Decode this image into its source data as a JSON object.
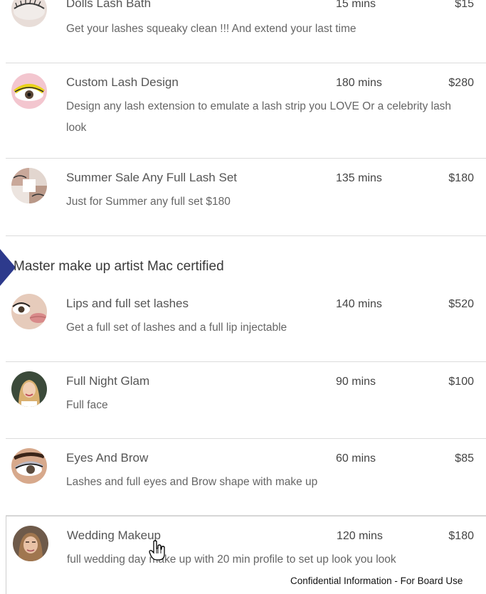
{
  "services_top": [
    {
      "name": "Dolls Lash Bath",
      "duration": "15 mins",
      "price": "$15",
      "description": "Get your lashes squeaky clean !!! And extend your last time",
      "avatar": "lash-eye-avatar"
    },
    {
      "name": "Custom Lash Design",
      "duration": "180 mins",
      "price": "$280",
      "description": "Design any lash extension to emulate a lash strip you LOVE Or a celebrity lash look",
      "avatar": "yellow-lash-avatar"
    },
    {
      "name": "Summer Sale Any Full Lash Set",
      "duration": "135 mins",
      "price": "$180",
      "description": "Just for Summer any full set $180",
      "avatar": "collage-avatar"
    }
  ],
  "section": {
    "title": "Master make up artist Mac certified"
  },
  "services_section": [
    {
      "name": "Lips and full set lashes",
      "duration": "140 mins",
      "price": "$520",
      "description": "Get a full set of lashes and a full lip injectable",
      "avatar": "lips-eye-avatar"
    },
    {
      "name": "Full Night Glam",
      "duration": "90 mins",
      "price": "$100",
      "description": "Full face",
      "avatar": "glam-portrait-avatar"
    },
    {
      "name": "Eyes And Brow",
      "duration": "60 mins",
      "price": "$85",
      "description": "Lashes and full eyes and Brow shape with make up",
      "avatar": "eye-brow-avatar"
    },
    {
      "name": "Wedding Makeup",
      "duration": "120 mins",
      "price": "$180",
      "description": "full wedding day make up with 20 min profile to set up look you look",
      "avatar": "bride-portrait-avatar"
    }
  ],
  "footer": {
    "text": "Confidential Information - For Board Use"
  },
  "colors": {
    "accent_arrow": "#2d3a8c",
    "divider": "#dcdcdc"
  }
}
